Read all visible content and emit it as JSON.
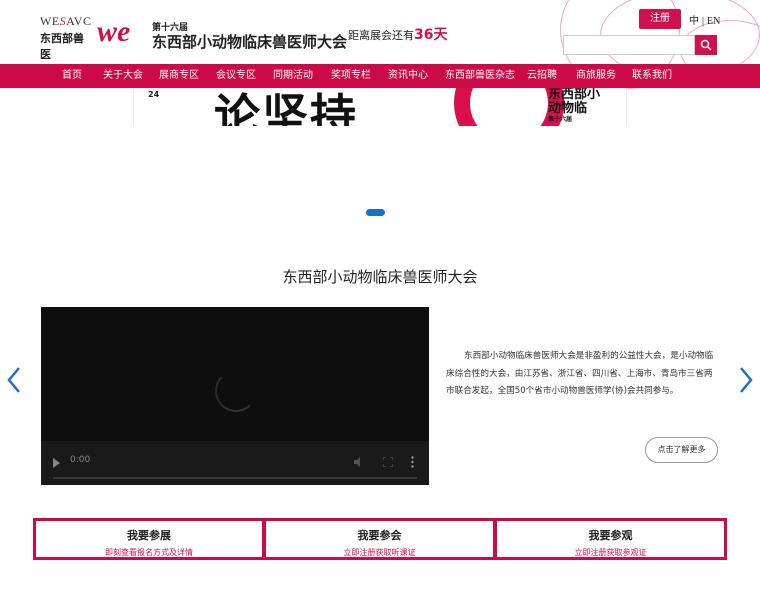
{
  "header": {
    "logo_brand_left": "WE",
    "logo_brand_s": "S",
    "logo_brand_right": "AVC",
    "logo_sub": "东西部兽医",
    "logo_we": "we",
    "edition": "第十六届",
    "conference_name": "东西部小动物临床兽医师大会",
    "countdown_prefix": "距离展会还有",
    "countdown_days": "36天",
    "register_label": "注册",
    "lang_zh": "中",
    "lang_sep": "|",
    "lang_en": "EN",
    "search_placeholder": ""
  },
  "nav": {
    "items": [
      "首页",
      "关于大会",
      "展商专区",
      "会议专区",
      "同期活动",
      "奖项专栏",
      "资讯中心",
      "东西部兽医杂志",
      "云招聘",
      "商旅服务",
      "联系我们"
    ]
  },
  "banner": {
    "number": "24",
    "calligraphy": "论坚持",
    "side_text": "东西部小动物临",
    "side_small": "第十六届"
  },
  "section": {
    "title": "东西部小动物临床兽医师大会"
  },
  "video": {
    "time": "0:00"
  },
  "intro": {
    "text": "东西部小动物临床兽医师大会是非盈利的公益性大会，是小动物临床综合性的大会，由江苏省、浙江省、四川省、上海市、青岛市三省两市联合发起，全国50个省市小动物兽医师学(协)会共同参与。",
    "more_label": "点击了解更多"
  },
  "boxes": [
    {
      "title": "我要参展",
      "sub": "即刻查看报名方式及详情"
    },
    {
      "title": "我要参会",
      "sub": "立即注册获取听课证"
    },
    {
      "title": "我要参观",
      "sub": "立即注册获取参观证"
    }
  ],
  "colors": {
    "brand": "#cc0a47",
    "accent_blue": "#1e6fc5"
  },
  "icons": {
    "search": "search-icon",
    "prev": "chevron-left-icon",
    "next": "chevron-right-icon"
  }
}
